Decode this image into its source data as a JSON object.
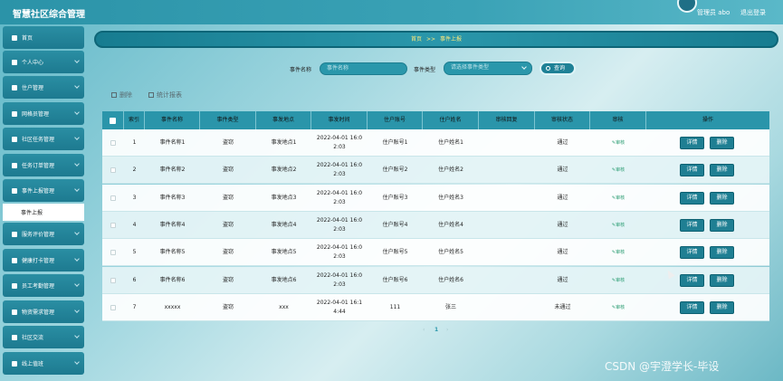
{
  "app": {
    "title": "智慧社区综合管理"
  },
  "header": {
    "user": "管理员 abo",
    "logout": "退出登录"
  },
  "sidebar": {
    "items": [
      {
        "label": "首页"
      },
      {
        "label": "个人中心"
      },
      {
        "label": "住户管理"
      },
      {
        "label": "网格员管理"
      },
      {
        "label": "社区任务管理"
      },
      {
        "label": "任务订单管理"
      },
      {
        "label": "事件上报管理"
      },
      {
        "label": "服务评价管理"
      },
      {
        "label": "健康打卡管理"
      },
      {
        "label": "员工考勤管理"
      },
      {
        "label": "物资需求管理"
      },
      {
        "label": "社区交流"
      },
      {
        "label": "线上值班"
      }
    ],
    "active_sub": "事件上报"
  },
  "breadcrumb": {
    "home": "首页",
    "sep": ">>",
    "current": "事件上报"
  },
  "search": {
    "name_label": "事件名称",
    "name_placeholder": "事件名称",
    "type_label": "事件类型",
    "type_placeholder": "请选择事件类型",
    "query_button": "查询"
  },
  "toolbar": {
    "delete": "删除",
    "report": "统计报表"
  },
  "table": {
    "headers": [
      "",
      "索引",
      "事件名称",
      "事件类型",
      "事发地点",
      "事发时间",
      "住户账号",
      "住户姓名",
      "审核回复",
      "审核状态",
      "审核",
      "操作"
    ],
    "audit_link": "审核",
    "detail_button": "详情",
    "delete_button": "删除",
    "rows": [
      {
        "idx": "1",
        "name": "事件名称1",
        "type": "盗窃",
        "place": "事发地点1",
        "time1": "2022-04-01 16:0",
        "time2": "2:03",
        "account": "住户账号1",
        "resident": "住户姓名1",
        "reply": "",
        "status": "通过"
      },
      {
        "idx": "2",
        "name": "事件名称2",
        "type": "盗窃",
        "place": "事发地点2",
        "time1": "2022-04-01 16:0",
        "time2": "2:03",
        "account": "住户账号2",
        "resident": "住户姓名2",
        "reply": "",
        "status": "通过"
      },
      {
        "idx": "3",
        "name": "事件名称3",
        "type": "盗窃",
        "place": "事发地点3",
        "time1": "2022-04-01 16:0",
        "time2": "2:03",
        "account": "住户账号3",
        "resident": "住户姓名3",
        "reply": "",
        "status": "通过"
      },
      {
        "idx": "4",
        "name": "事件名称4",
        "type": "盗窃",
        "place": "事发地点4",
        "time1": "2022-04-01 16:0",
        "time2": "2:03",
        "account": "住户账号4",
        "resident": "住户姓名4",
        "reply": "",
        "status": "通过"
      },
      {
        "idx": "5",
        "name": "事件名称5",
        "type": "盗窃",
        "place": "事发地点5",
        "time1": "2022-04-01 16:0",
        "time2": "2:03",
        "account": "住户账号5",
        "resident": "住户姓名5",
        "reply": "",
        "status": "通过"
      },
      {
        "idx": "6",
        "name": "事件名称6",
        "type": "盗窃",
        "place": "事发地点6",
        "time1": "2022-04-01 16:0",
        "time2": "2:03",
        "account": "住户账号6",
        "resident": "住户姓名6",
        "reply": "",
        "status": "通过"
      },
      {
        "idx": "7",
        "name": "xxxxx",
        "type": "盗窃",
        "place": "xxx",
        "time1": "2022-04-01 16:1",
        "time2": "4:44",
        "account": "111",
        "resident": "张三",
        "reply": "",
        "status": "未通过"
      }
    ]
  },
  "pager": {
    "prev": "‹",
    "page": "1",
    "next": "›"
  },
  "watermark": "CSDN @宇澄学长-毕设"
}
